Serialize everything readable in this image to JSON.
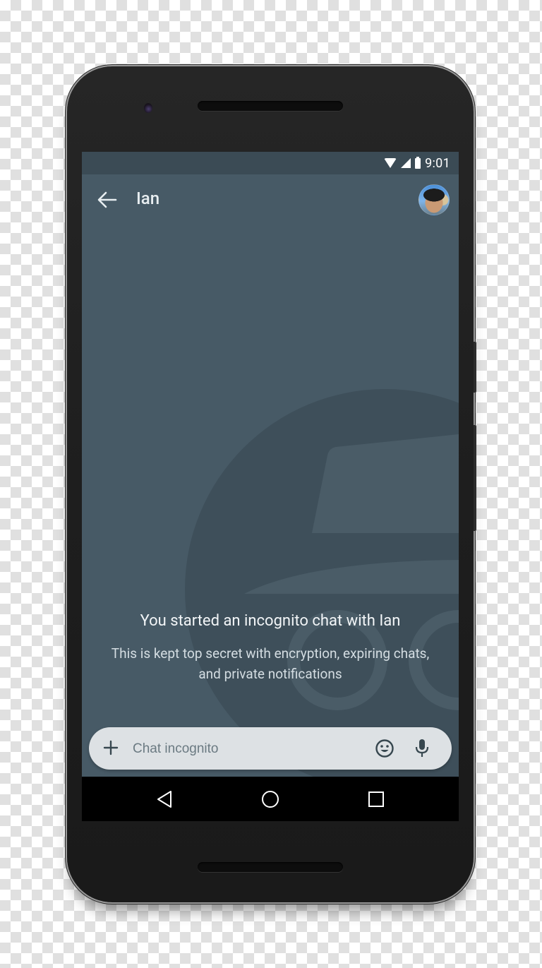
{
  "status_bar": {
    "time": "9:01",
    "icons": [
      "wifi-icon",
      "cell-signal-icon",
      "battery-icon"
    ]
  },
  "app_bar": {
    "back_icon": "arrow-back-icon",
    "title": "Ian",
    "avatar_alt": "Ian profile photo"
  },
  "conversation": {
    "watermark_icon": "incognito-icon",
    "intro_title": "You started an incognito chat with Ian",
    "intro_body": "This is kept top secret with encryption, expiring chats, and private notifications"
  },
  "composer": {
    "add_icon": "plus-icon",
    "placeholder": "Chat incognito",
    "value": "",
    "emoji_icon": "emoji-icon",
    "mic_icon": "microphone-icon"
  },
  "nav_bar": {
    "buttons": [
      "back-triangle-icon",
      "home-circle-icon",
      "recents-square-icon"
    ]
  },
  "colors": {
    "screen_bg": "#475a66",
    "status_bar_bg": "#3b4b55",
    "composer_bg": "#dde1e4",
    "nav_bar_bg": "#000000",
    "watermark": "#3e4f5a"
  }
}
